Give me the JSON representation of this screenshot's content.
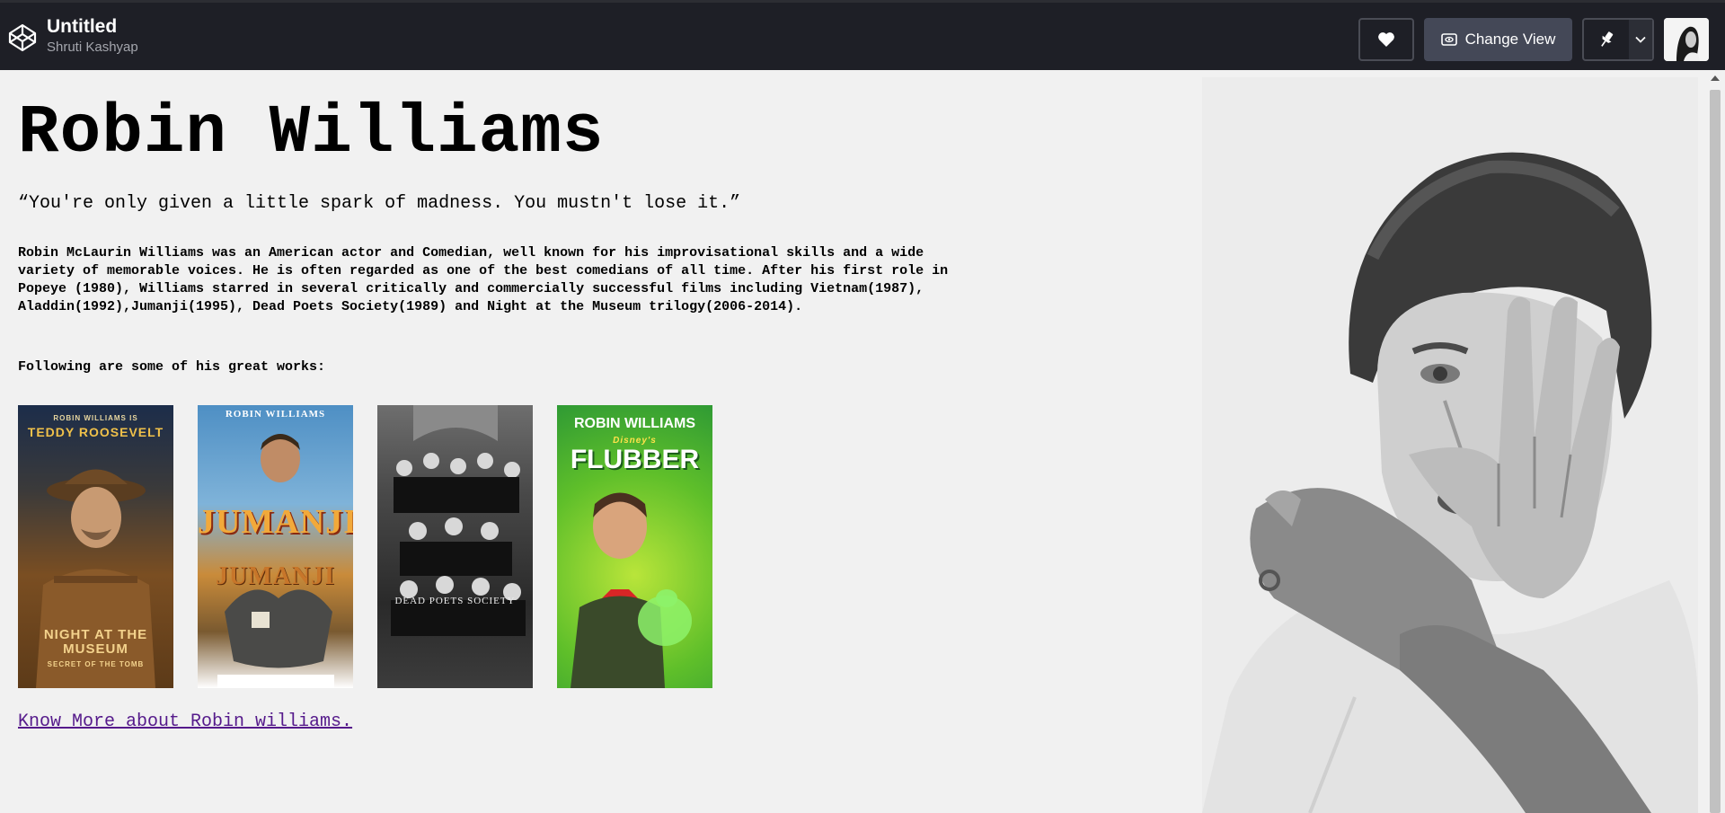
{
  "topbar": {
    "title": "Untitled",
    "author": "Shruti Kashyap",
    "change_view_label": "Change View",
    "icons": [
      "codepen-logo-icon",
      "heart-icon",
      "eye-icon",
      "pin-icon",
      "chevron-down-icon"
    ]
  },
  "page": {
    "heading": "Robin Williams",
    "quote": "“You're only given a little spark of madness. You mustn't lose it.”",
    "bio": "Robin McLaurin Williams was an American actor and Comedian, well known for his improvisational skills and a wide variety of memorable voices. He is often regarded as one of the best comedians of all time. After his first role in Popeye (1980), Williams starred in several critically and commercially successful films including Vietnam(1987), Aladdin(1992),Jumanji(1995), Dead Poets Society(1989) and Night at the Museum trilogy(2006-2014).",
    "following": "Following are some of his great works:",
    "posters": [
      {
        "top": "ROBIN WILLIAMS IS",
        "name": "TEDDY ROOSEVELT",
        "title": "NIGHT AT THE MUSEUM",
        "sub": "SECRET OF THE TOMB"
      },
      {
        "top": "ROBIN WILLIAMS",
        "title": "JUMANJI"
      },
      {
        "title": "DEAD POETS SOCIETY"
      },
      {
        "top": "ROBIN WILLIAMS",
        "sub": "Disney's",
        "title": "FLUBBER"
      }
    ],
    "link_text": "Know More about Robin williams."
  }
}
